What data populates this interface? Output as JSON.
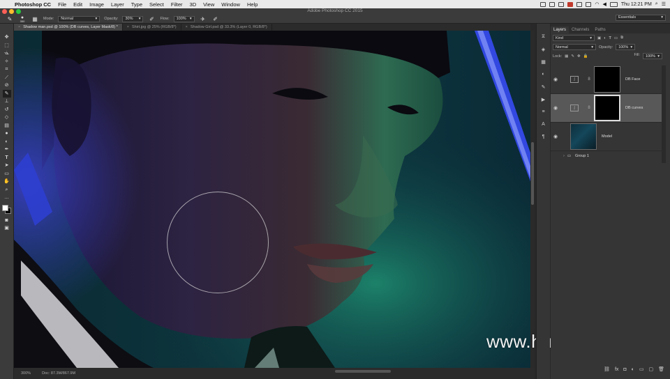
{
  "menubar": {
    "app_name": "Photoshop CC",
    "items": [
      "File",
      "Edit",
      "Image",
      "Layer",
      "Type",
      "Select",
      "Filter",
      "3D",
      "View",
      "Window",
      "Help"
    ],
    "clock": "Thu 12:21 PM"
  },
  "window": {
    "title": "Adobe Photoshop CC 2015"
  },
  "options": {
    "brush_size": "350",
    "mode_label": "Mode:",
    "mode_value": "Normal",
    "opacity_label": "Opacity:",
    "opacity_value": "30%",
    "flow_label": "Flow:",
    "flow_value": "100%",
    "workspace": "Essentials"
  },
  "tabs": [
    {
      "label": "Shadow man.psd @ 100% (DB curves, Layer Mask/8) *",
      "close": "×"
    },
    {
      "label": "Shirt.jpg @ 25% (RGB/8*)",
      "close": "×"
    },
    {
      "label": "Shadow Girl.psd @ 33.3% (Layer 0, RGB/8*)",
      "close": "×"
    }
  ],
  "toolbar_icons": [
    "move-icon",
    "marquee-icon",
    "lasso-icon",
    "quick-select-icon",
    "crop-icon",
    "eyedropper-icon",
    "healing-icon",
    "brush-icon",
    "stamp-icon",
    "history-brush-icon",
    "eraser-icon",
    "gradient-icon",
    "blur-icon",
    "dodge-icon",
    "pen-icon",
    "type-icon",
    "path-select-icon",
    "shape-icon",
    "hand-icon",
    "zoom-icon",
    "more-icon"
  ],
  "status": {
    "zoom": "300%",
    "doc": "Doc: 87.3M/867.9M"
  },
  "watermark": "www.hunls.com",
  "layers_panel": {
    "tabs": [
      "Layers",
      "Channels",
      "Paths"
    ],
    "filter_kind": "Kind",
    "blend_mode": "Normal",
    "opacity_label": "Opacity:",
    "opacity_value": "100%",
    "lock_label": "Lock:",
    "fill_label": "Fill:",
    "fill_value": "100%",
    "layers": [
      {
        "name": "DB Face",
        "selected": false
      },
      {
        "name": "DB curves",
        "selected": true
      },
      {
        "name": "Model",
        "selected": false
      }
    ],
    "group": "Group 1"
  },
  "colors": {
    "accent_blue": "#2b56d6",
    "teal": "#15766a",
    "panel": "#353535"
  }
}
